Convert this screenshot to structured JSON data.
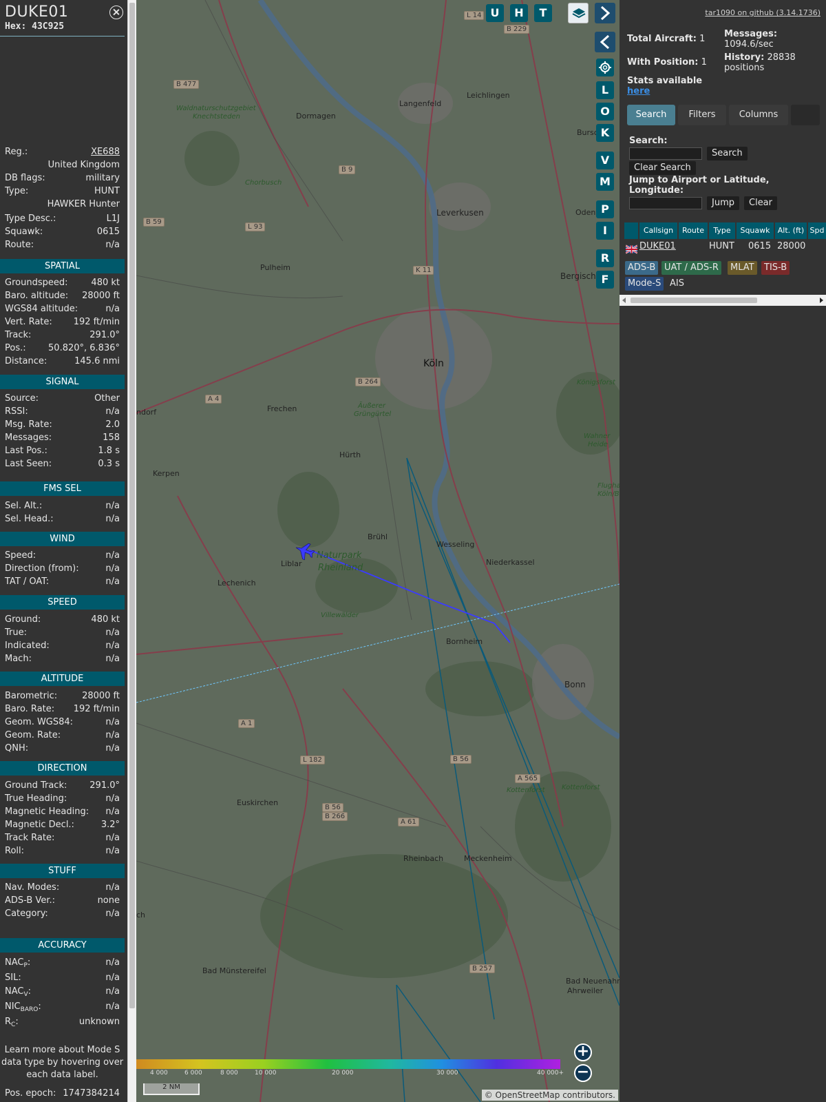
{
  "aircraft": {
    "callsign": "DUKE01",
    "hex": "Hex: 43C925"
  },
  "info": {
    "reg_label": "Reg.:",
    "reg_value": "XE688",
    "country": "United Kingdom",
    "dbflags_label": "DB flags:",
    "dbflags_value": "military",
    "type_label": "Type:",
    "type_value": "HUNT",
    "type_name": "HAWKER Hunter",
    "typedesc_label": "Type Desc.:",
    "typedesc_value": "L1J",
    "squawk_label": "Squawk:",
    "squawk_value": "0615",
    "route_label": "Route:",
    "route_value": "n/a"
  },
  "sections": {
    "spatial": "SPATIAL",
    "signal": "SIGNAL",
    "fms": "FMS SEL",
    "wind": "WIND",
    "speed": "SPEED",
    "altitude": "ALTITUDE",
    "direction": "DIRECTION",
    "stuff": "STUFF",
    "accuracy": "ACCURACY"
  },
  "spatial": [
    {
      "label": "Groundspeed:",
      "value": "480 kt"
    },
    {
      "label": "Baro. altitude:",
      "value": "28000 ft"
    },
    {
      "label": "WGS84 altitude:",
      "value": "n/a"
    },
    {
      "label": "Vert. Rate:",
      "value": "192 ft/min"
    },
    {
      "label": "Track:",
      "value": "291.0°"
    },
    {
      "label": "Pos.:",
      "value": "50.820°, 6.836°"
    },
    {
      "label": "Distance:",
      "value": "145.6 nmi"
    }
  ],
  "signal": [
    {
      "label": "Source:",
      "value": "Other"
    },
    {
      "label": "RSSI:",
      "value": "n/a"
    },
    {
      "label": "Msg. Rate:",
      "value": "2.0"
    },
    {
      "label": "Messages:",
      "value": "158"
    },
    {
      "label": "Last Pos.:",
      "value": "1.8 s"
    },
    {
      "label": "Last Seen:",
      "value": "0.3 s"
    }
  ],
  "fms": [
    {
      "label": "Sel. Alt.:",
      "value": "n/a"
    },
    {
      "label": "Sel. Head.:",
      "value": "n/a"
    }
  ],
  "wind": [
    {
      "label": "Speed:",
      "value": "n/a"
    },
    {
      "label": "Direction (from):",
      "value": "n/a"
    },
    {
      "label": "TAT / OAT:",
      "value": "n/a"
    }
  ],
  "speed": [
    {
      "label": "Ground:",
      "value": "480 kt"
    },
    {
      "label": "True:",
      "value": "n/a"
    },
    {
      "label": "Indicated:",
      "value": "n/a"
    },
    {
      "label": "Mach:",
      "value": "n/a"
    }
  ],
  "altitude": [
    {
      "label": "Barometric:",
      "value": "28000 ft"
    },
    {
      "label": "Baro. Rate:",
      "value": "192 ft/min"
    },
    {
      "label": "Geom. WGS84:",
      "value": "n/a"
    },
    {
      "label": "Geom. Rate:",
      "value": "n/a"
    },
    {
      "label": "QNH:",
      "value": "n/a"
    }
  ],
  "direction": [
    {
      "label": "Ground Track:",
      "value": "291.0°"
    },
    {
      "label": "True Heading:",
      "value": "n/a"
    },
    {
      "label": "Magnetic Heading:",
      "value": "n/a"
    },
    {
      "label": "Magnetic Decl.:",
      "value": "3.2°"
    },
    {
      "label": "Track Rate:",
      "value": "n/a"
    },
    {
      "label": "Roll:",
      "value": "n/a"
    }
  ],
  "stuff": [
    {
      "label": "Nav. Modes:",
      "value": "n/a"
    },
    {
      "label": "ADS-B Ver.:",
      "value": "none"
    },
    {
      "label": "Category:",
      "value": "n/a"
    }
  ],
  "accuracy": {
    "nacp_main": "NAC",
    "nacp_sub": "P",
    "nacp_value": "n/a",
    "sil_label": "SIL:",
    "sil_value": "n/a",
    "nacv_main": "NAC",
    "nacv_sub": "V",
    "nacv_value": "n/a",
    "nicbaro_main": "NIC",
    "nicbaro_sub": "BARO",
    "nicbaro_value": "n/a",
    "rc_main": "R",
    "rc_sub": "C",
    "rc_value": "unknown"
  },
  "learn_more": "Learn more about Mode S data type by hovering over each data label.",
  "pos_epoch_label": "Pos. epoch:",
  "pos_epoch_value": "1747384214",
  "map": {
    "attribution": "© OpenStreetMap contributors.",
    "scale": "2 NM",
    "zoom_in": "+",
    "zoom_out": "−",
    "altitude_ticks": [
      "4 000",
      "6 000",
      "8 000",
      "10 000",
      "20 000",
      "30 000",
      "40 000+"
    ],
    "places": {
      "koln": "Köln",
      "leverkusen": "Leverkusen",
      "bonn": "Bonn",
      "dormagen": "Dormagen",
      "langenfeld": "Langenfeld",
      "leichlingen": "Leichlingen",
      "pulheim": "Pulheim",
      "frechen": "Frechen",
      "hurth": "Hürth",
      "bruhl": "Brühl",
      "wesseling": "Wesseling",
      "niederkassel": "Niederkassel",
      "kerpen": "Kerpen",
      "liblar": "Liblar",
      "lechenich": "Lechenich",
      "bornheim": "Bornheim",
      "euskirchen": "Euskirchen",
      "rheinbach": "Rheinbach",
      "meckenheim": "Meckenheim",
      "bad_muenstereifel": "Bad Münstereifel",
      "bad_neuenahr": "Bad Neuenahr-",
      "ahrweiler": "Ahrweiler",
      "bergisch": "Bergisch",
      "odenthal": "Odent",
      "bursc": "Bursc",
      "villewalder": "Villewälder",
      "naturpark": "Naturpark",
      "rheinland": "Rheinland",
      "aussere": "Äußerer",
      "grungurtel": "Grüngürtel",
      "waldnatur": "Waldnaturschutzgebiet",
      "knechtsteden": "Knechtsteden",
      "chorbusch": "Chorbusch",
      "konigsforst": "Königsforst",
      "wahner": "Wahner",
      "heide": "Heide",
      "kottenforst": "Kottenforst",
      "kottenforst2": "Kottenforst",
      "flughafen": "Flughafen",
      "kolnbonn": "Köln/Bo",
      "ndorf": "ndorf",
      "ch": "ch"
    },
    "roads": [
      "B 477",
      "B 9",
      "B 59",
      "L 93",
      "K 11",
      "B 264",
      "A 4",
      "L 182",
      "A 1",
      "B 56",
      "B 266",
      "A 61",
      "B 56",
      "A 565",
      "B 257",
      "L 14",
      "B 229"
    ]
  },
  "map_buttons": {
    "u": "U",
    "h": "H",
    "t": "T",
    "l": "L",
    "o": "O",
    "k": "K",
    "v": "V",
    "m": "M",
    "p": "P",
    "i": "I",
    "r": "R",
    "f": "F"
  },
  "right": {
    "github": "tar1090 on github (3.14.1736)",
    "total_label": "Total Aircraft:",
    "total_value": "1",
    "messages_label": "Messages:",
    "messages_value": "1094.6/sec",
    "withpos_label": "With Position:",
    "withpos_value": "1",
    "history_label": "History:",
    "history_value": "28838",
    "history_unit": "positions",
    "stats_label": "Stats available",
    "stats_link": "here",
    "tabs": [
      "Search",
      "Filters",
      "Columns"
    ],
    "search_label": "Search:",
    "search_button": "Search",
    "clear_search": "Clear Search",
    "jump_label": "Jump to Airport or Latitude, Longitude:",
    "jump_button": "Jump",
    "clear_button": "Clear",
    "columns": [
      "Callsign",
      "Route",
      "Type",
      "Squawk",
      "Alt. (ft)",
      "Spd"
    ],
    "row": {
      "callsign": "DUKE01",
      "route": "",
      "type": "HUNT",
      "squawk": "0615",
      "alt": "28000"
    },
    "sources": [
      "ADS-B",
      "UAT / ADS-R",
      "MLAT",
      "TIS-B",
      "Mode-S",
      "AIS"
    ]
  },
  "colors": {
    "section_header": "#00596b",
    "panel_bg": "#333333",
    "track_line": "#3b3bff",
    "adsb": "#3b6a8a",
    "uat": "#2e6a4a",
    "mlat": "#6a5a2a",
    "tisb": "#7a2a2a",
    "modes": "#2a4a7a"
  }
}
